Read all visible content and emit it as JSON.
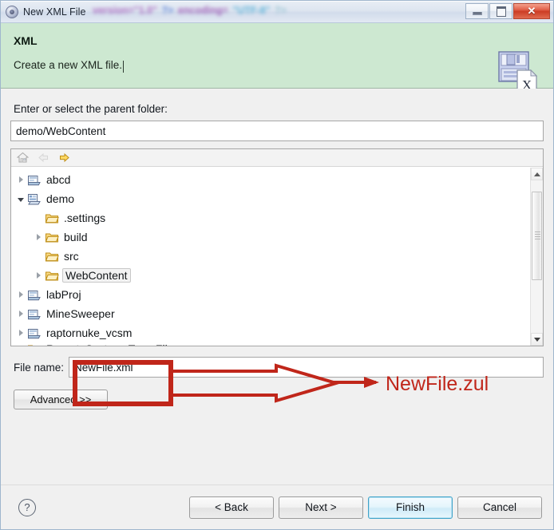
{
  "window": {
    "title": "New XML File",
    "title_icon": "xml-file-icon",
    "ghost_text_fragments": [
      "version=\"1.0\"",
      "?>",
      "encoding=",
      "\"UTF-8\"",
      "?>"
    ],
    "controls": {
      "minimize": "minimize-button",
      "maximize": "maximize-button",
      "close_label": "✕"
    }
  },
  "header": {
    "title": "XML",
    "subtitle": "Create a new XML file.",
    "banner_icon": "floppy-disk-xml-icon",
    "background_color": "#cde8d1"
  },
  "form": {
    "parent_folder_label": "Enter or select the parent folder:",
    "parent_folder_value": "demo/WebContent",
    "parent_folder_placeholder": "",
    "file_name_label": "File name:",
    "file_name_value": "NewFile.xml",
    "file_name_placeholder": "",
    "advanced_label": "Advanced >>"
  },
  "tree_toolbar": {
    "buttons": [
      {
        "name": "home-icon",
        "enabled": true
      },
      {
        "name": "back-arrow-icon",
        "enabled": false
      },
      {
        "name": "forward-arrow-icon",
        "enabled": true
      }
    ]
  },
  "tree": {
    "items": [
      {
        "label": "abcd",
        "indent": 0,
        "twisty": "closed",
        "icon": "project-closed-icon",
        "selected": false,
        "clipped": false
      },
      {
        "label": "demo",
        "indent": 0,
        "twisty": "open",
        "icon": "project-open-icon",
        "selected": false,
        "clipped": false
      },
      {
        "label": ".settings",
        "indent": 1,
        "twisty": "none",
        "icon": "folder-icon",
        "selected": false,
        "clipped": false
      },
      {
        "label": "build",
        "indent": 1,
        "twisty": "closed",
        "icon": "folder-icon",
        "selected": false,
        "clipped": false
      },
      {
        "label": "src",
        "indent": 1,
        "twisty": "none",
        "icon": "folder-icon",
        "selected": false,
        "clipped": false
      },
      {
        "label": "WebContent",
        "indent": 1,
        "twisty": "closed",
        "icon": "folder-icon",
        "selected": true,
        "clipped": false
      },
      {
        "label": "labProj",
        "indent": 0,
        "twisty": "closed",
        "icon": "project-closed-icon",
        "selected": false,
        "clipped": false
      },
      {
        "label": "MineSweeper",
        "indent": 0,
        "twisty": "closed",
        "icon": "project-closed-icon",
        "selected": false,
        "clipped": false
      },
      {
        "label": "raptornuke_vcsm",
        "indent": 0,
        "twisty": "closed",
        "icon": "project-closed-icon",
        "selected": false,
        "clipped": false
      },
      {
        "label": "RemoteSystemsTempFiles",
        "indent": 0,
        "twisty": "none",
        "icon": "folder-icon",
        "selected": false,
        "clipped": true
      }
    ],
    "scrollbar": {
      "name": "vertical-scrollbar",
      "thumb_top_pct": 7,
      "thumb_height_pct": 58
    }
  },
  "footer": {
    "help_label": "?",
    "buttons": [
      {
        "name": "back-button",
        "label": "< Back",
        "primary": false
      },
      {
        "name": "next-button",
        "label": "Next >",
        "primary": false
      },
      {
        "name": "finish-button",
        "label": "Finish",
        "primary": true
      },
      {
        "name": "cancel-button",
        "label": "Cancel",
        "primary": false
      }
    ]
  },
  "annotation": {
    "color": "#c0261a",
    "text": "NewFile.zul",
    "shapes": [
      "highlight-rectangle-around-file-name-field",
      "right-pointing-hollow-arrow"
    ]
  }
}
